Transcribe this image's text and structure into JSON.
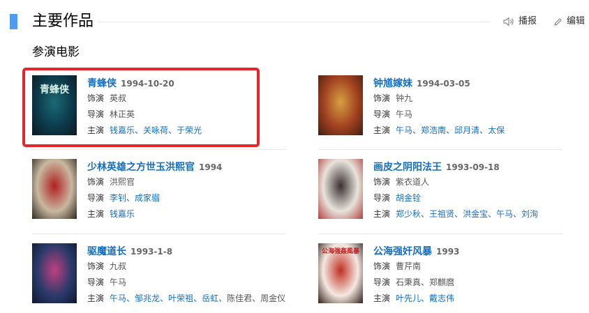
{
  "header": {
    "title": "主要作品",
    "play_label": "播报",
    "edit_label": "编辑",
    "accent_color": "#4f9cee"
  },
  "subheading": "参演电影",
  "labels": {
    "role": "饰演",
    "director": "导演",
    "cast": "主演"
  },
  "works": [
    {
      "title": "青蜂侠",
      "date": "1994-10-20",
      "role": "英叔",
      "director": [
        "林正英"
      ],
      "director_links": false,
      "cast": [
        "钱嘉乐",
        "关咏荷",
        "于荣光"
      ],
      "poster": {
        "caption": "青蜂侠",
        "colors": [
          "#0d3a4a",
          "#1a6a75",
          "#0a1a22"
        ]
      },
      "highlighted": true
    },
    {
      "title": "钟馗嫁妹",
      "date": "1994-03-05",
      "role": "钟九",
      "director": [
        "午马"
      ],
      "director_links": false,
      "cast": [
        "午马",
        "郑浩南",
        "邱月清",
        "太保"
      ],
      "poster": {
        "caption": "",
        "colors": [
          "#a04020",
          "#d8a040",
          "#402010"
        ]
      },
      "highlighted": false
    },
    {
      "title": "少林英雄之方世玉洪熙官",
      "date": "1994",
      "role": "洪熙官",
      "director": [
        "李钊",
        "成家骝"
      ],
      "director_links": true,
      "cast": [
        "钱嘉乐"
      ],
      "poster": {
        "caption": "",
        "colors": [
          "#c8b8a0",
          "#b02020",
          "#302820"
        ]
      },
      "highlighted": false
    },
    {
      "title": "画皮之阴阳法王",
      "date": "1993-09-18",
      "role": "紫衣道人",
      "director": [
        "胡金铨"
      ],
      "director_links": true,
      "cast": [
        "郑少秋",
        "王祖贤",
        "洪金宝",
        "午马",
        "刘洵"
      ],
      "poster": {
        "caption": "",
        "colors": [
          "#e8e4dc",
          "#3a3030",
          "#b04040"
        ]
      },
      "highlighted": false
    },
    {
      "title": "驱魔道长",
      "date": "1993-1-8",
      "role": "九叔",
      "director": [
        "午马"
      ],
      "director_links": false,
      "cast": [
        "午马",
        "邹兆龙",
        "叶荣祖",
        "岳虹",
        "陈佳君",
        "周金仪"
      ],
      "cast_link_count": 4,
      "poster": {
        "caption": "",
        "colors": [
          "#2a3a6a",
          "#c04080",
          "#101830"
        ]
      },
      "highlighted": false
    },
    {
      "title": "公海强奸风暴",
      "date": "1993",
      "role": "曹芹南",
      "director": [
        "石秉真",
        "郑麒麿"
      ],
      "director_links": false,
      "cast": [
        "叶先儿",
        "戴志伟"
      ],
      "poster": {
        "caption": "公海強姦風暴",
        "colors": [
          "#f4e8e0",
          "#c03020",
          "#302018"
        ]
      },
      "highlighted": false
    }
  ]
}
